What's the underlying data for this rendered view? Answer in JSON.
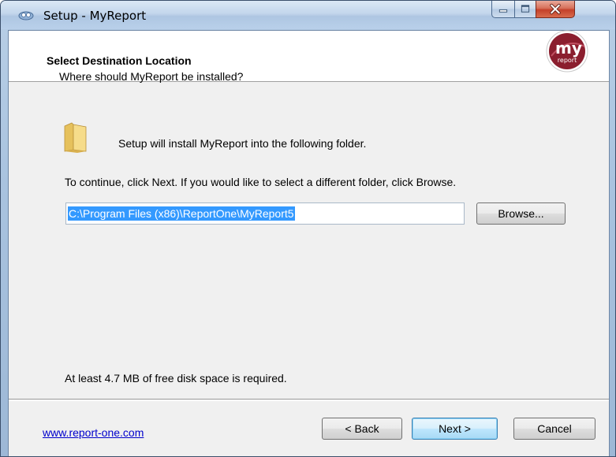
{
  "window": {
    "title": "Setup - MyReport",
    "controls": {
      "minimize": "minimize-icon",
      "maximize": "maximize-icon",
      "close": "close-icon"
    }
  },
  "header": {
    "title": "Select Destination Location",
    "subtitle": "Where should MyReport be installed?",
    "logo": {
      "top_text": "my",
      "bottom_text": "report"
    }
  },
  "main": {
    "intro": "Setup will install MyReport into the following folder.",
    "instruction": "To continue, click Next. If you would like to select a different folder, click Browse.",
    "path_value": "C:\\Program Files (x86)\\ReportOne\\MyReport5",
    "browse_label": "Browse...",
    "disk_space": "At least 4.7 MB of free disk space is required."
  },
  "footer": {
    "link": "www.report-one.com",
    "back_label": "< Back",
    "next_label": "Next >",
    "cancel_label": "Cancel"
  },
  "colors": {
    "selection": "#3399ff",
    "link": "#0000cc",
    "logo": "#8b1e2e",
    "folder": "#f2d27a"
  }
}
